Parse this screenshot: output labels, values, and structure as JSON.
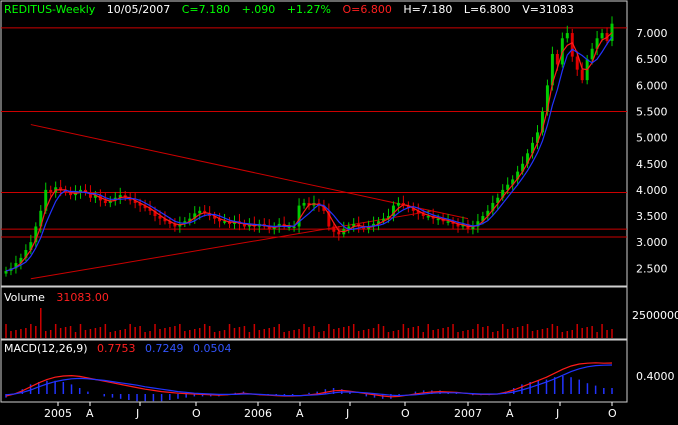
{
  "header": {
    "symbol": "REDITUS-Weekly",
    "date": "10/05/2007",
    "close": "C=7.180",
    "change": "+.090",
    "change_pct": "+1.27%",
    "open": "O=6.800",
    "high": "H=7.180",
    "low": "L=6.800",
    "volume": "V=31083"
  },
  "volume_panel": {
    "label": "Volume",
    "value": "31083.00",
    "axis_tick": "2500000"
  },
  "macd_panel": {
    "label": "MACD(12,26,9)",
    "macd": "0.7753",
    "signal": "0.7249",
    "hist": "0.0504",
    "axis_tick": "0.4000"
  },
  "colors": {
    "background": "#000000",
    "up_candle": "#00cc00",
    "down_candle": "#e00000",
    "ma_fast": "#ff1a1a",
    "ma_slow": "#2233ff",
    "grid": "#cc0000",
    "axis_text": "#ffffff",
    "title_text": "#00ff00",
    "value_text": "#ff2020"
  },
  "chart_data": [
    {
      "type": "candlestick",
      "panel": "price",
      "y_ticks": [
        "2.500",
        "3.000",
        "3.500",
        "4.000",
        "4.500",
        "5.000",
        "5.500",
        "6.000",
        "6.500",
        "7.000"
      ],
      "ylim": [
        2.2,
        7.25
      ],
      "x_ticks": [
        "2005",
        "A",
        "J",
        "O",
        "2006",
        "A",
        "J",
        "O",
        "2007",
        "A",
        "J",
        "O"
      ],
      "horizontal_lines": [
        7.1,
        5.5,
        3.95,
        3.25,
        3.1
      ],
      "close": [
        2.45,
        2.5,
        2.6,
        2.7,
        2.85,
        3.0,
        3.3,
        3.6,
        4.0,
        3.95,
        4.05,
        4.0,
        3.95,
        3.9,
        3.95,
        4.0,
        3.95,
        3.85,
        3.9,
        3.8,
        3.75,
        3.8,
        3.85,
        3.9,
        3.85,
        3.8,
        3.75,
        3.7,
        3.65,
        3.6,
        3.5,
        3.45,
        3.4,
        3.35,
        3.3,
        3.35,
        3.4,
        3.45,
        3.55,
        3.6,
        3.55,
        3.5,
        3.45,
        3.4,
        3.4,
        3.35,
        3.4,
        3.35,
        3.3,
        3.35,
        3.3,
        3.35,
        3.3,
        3.25,
        3.3,
        3.35,
        3.3,
        3.3,
        3.3,
        3.7,
        3.75,
        3.7,
        3.75,
        3.7,
        3.6,
        3.3,
        3.2,
        3.15,
        3.25,
        3.3,
        3.35,
        3.3,
        3.25,
        3.3,
        3.35,
        3.4,
        3.45,
        3.5,
        3.7,
        3.75,
        3.7,
        3.65,
        3.6,
        3.55,
        3.5,
        3.5,
        3.45,
        3.45,
        3.4,
        3.4,
        3.35,
        3.3,
        3.35,
        3.25,
        3.3,
        3.4,
        3.5,
        3.6,
        3.75,
        3.85,
        4.0,
        4.1,
        4.2,
        4.35,
        4.5,
        4.7,
        4.9,
        5.1,
        5.5,
        6.0,
        6.6,
        6.4,
        6.9,
        7.0,
        6.55,
        6.3,
        6.1,
        6.5,
        6.7,
        6.9,
        7.0,
        6.85,
        7.18
      ],
      "macd": [
        -0.05,
        0.0,
        0.08,
        0.18,
        0.28,
        0.36,
        0.42,
        0.45,
        0.46,
        0.44,
        0.4,
        0.36,
        0.32,
        0.28,
        0.24,
        0.2,
        0.16,
        0.12,
        0.09,
        0.06,
        0.04,
        0.02,
        0.01,
        0.0,
        -0.01,
        -0.02,
        -0.03,
        -0.02,
        0.0,
        0.02,
        0.0,
        -0.02,
        -0.03,
        -0.04,
        -0.05,
        -0.05,
        -0.04,
        -0.02,
        0.0,
        0.04,
        0.08,
        0.09,
        0.07,
        0.04,
        0.01,
        -0.02,
        -0.05,
        -0.07,
        -0.06,
        -0.03,
        0.0,
        0.03,
        0.05,
        0.06,
        0.05,
        0.04,
        0.02,
        0.0,
        -0.01,
        -0.01,
        0.0,
        0.04,
        0.1,
        0.18,
        0.26,
        0.34,
        0.42,
        0.52,
        0.62,
        0.7,
        0.75,
        0.77,
        0.78,
        0.77,
        0.775
      ],
      "signal": [
        -0.02,
        0.0,
        0.04,
        0.1,
        0.18,
        0.25,
        0.31,
        0.35,
        0.38,
        0.39,
        0.38,
        0.36,
        0.34,
        0.31,
        0.28,
        0.25,
        0.22,
        0.18,
        0.15,
        0.12,
        0.09,
        0.06,
        0.04,
        0.02,
        0.01,
        0.0,
        -0.01,
        -0.01,
        -0.01,
        0.0,
        0.0,
        -0.01,
        -0.02,
        -0.03,
        -0.04,
        -0.04,
        -0.04,
        -0.03,
        -0.02,
        0.0,
        0.03,
        0.05,
        0.05,
        0.04,
        0.03,
        0.01,
        -0.01,
        -0.03,
        -0.04,
        -0.03,
        -0.02,
        0.0,
        0.02,
        0.03,
        0.03,
        0.03,
        0.02,
        0.01,
        0.0,
        0.0,
        0.0,
        0.02,
        0.05,
        0.1,
        0.16,
        0.23,
        0.3,
        0.38,
        0.47,
        0.56,
        0.63,
        0.68,
        0.71,
        0.72,
        0.725
      ],
      "macd_ylim": [
        -0.15,
        0.95
      ]
    }
  ]
}
